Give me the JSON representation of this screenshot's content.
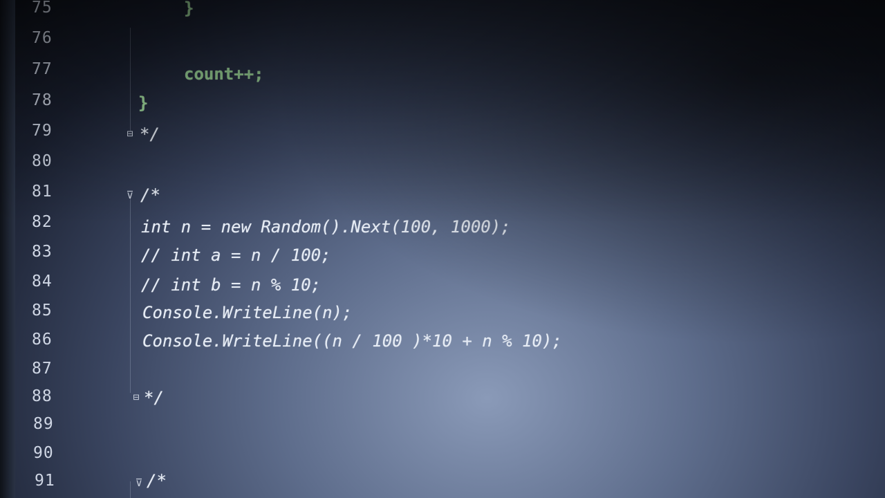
{
  "editor": {
    "lines": [
      {
        "number": "75",
        "code": "}"
      },
      {
        "number": "76",
        "code": ""
      },
      {
        "number": "77",
        "code": "count++;"
      },
      {
        "number": "78",
        "code": "}"
      },
      {
        "number": "79",
        "code": "*/"
      },
      {
        "number": "80",
        "code": ""
      },
      {
        "number": "81",
        "code": "/*"
      },
      {
        "number": "82",
        "code": "int n = new Random().Next(100, 1000);"
      },
      {
        "number": "83",
        "code": "// int a = n / 100;"
      },
      {
        "number": "84",
        "code": "// int b = n % 10;"
      },
      {
        "number": "85",
        "code": "Console.WriteLine(n);"
      },
      {
        "number": "86",
        "code": "Console.WriteLine((n / 100 )*10 + n % 10);"
      },
      {
        "number": "87",
        "code": ""
      },
      {
        "number": "88",
        "code": "*/"
      },
      {
        "number": "89",
        "code": ""
      },
      {
        "number": "90",
        "code": ""
      },
      {
        "number": "91",
        "code": "/*"
      }
    ],
    "colors": {
      "code_green": "#a6e6a2",
      "code_text": "#e6ecf5",
      "line_number": "#cfd6e4"
    },
    "icons": [
      "fold-end-icon",
      "fold-start-icon"
    ]
  }
}
